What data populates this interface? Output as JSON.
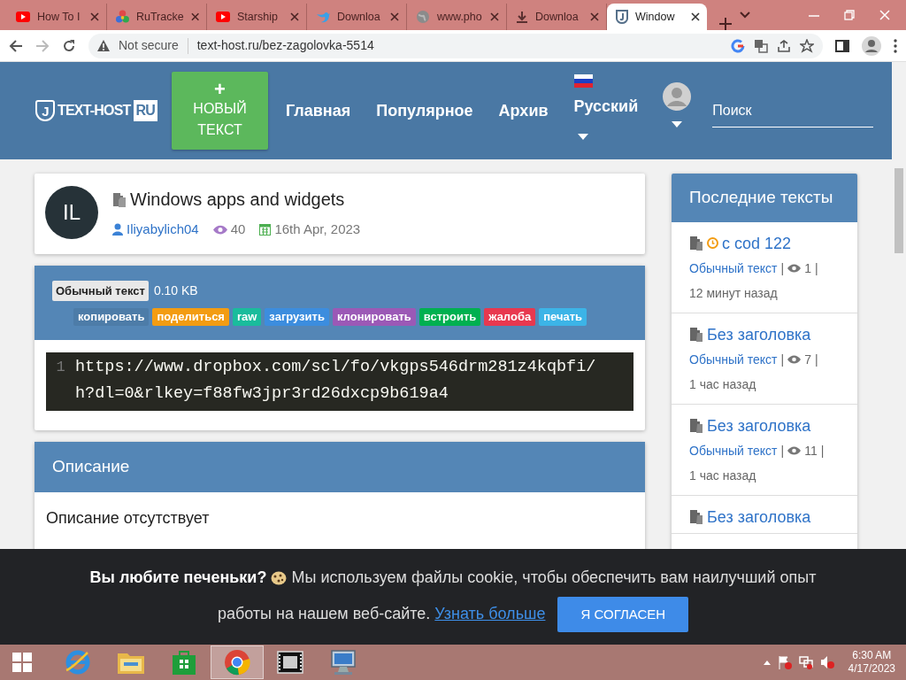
{
  "browser": {
    "tabs": [
      {
        "title": "How To I",
        "kind": "video",
        "selected": false
      },
      {
        "title": "RuTracke",
        "kind": "flower",
        "selected": false
      },
      {
        "title": "Starship",
        "kind": "video",
        "selected": false
      },
      {
        "title": "Downloa",
        "kind": "bird",
        "selected": false
      },
      {
        "title": "www.pho",
        "kind": "globe",
        "selected": false
      },
      {
        "title": "Downloa",
        "kind": "download",
        "selected": false
      },
      {
        "title": "Window",
        "kind": "shield",
        "selected": true
      }
    ],
    "nav_buttons": [
      {
        "kind": "back",
        "disabled": false
      },
      {
        "kind": "forward",
        "disabled": true
      },
      {
        "kind": "reload",
        "disabled": false
      }
    ],
    "security": "Not secure",
    "url": "text-host.ru/bez-zagolovka-5514"
  },
  "header": {
    "logo": {
      "mark": "J",
      "text": "TEXT-HOST",
      "suffix": "RU"
    },
    "new_button": {
      "icon": "+",
      "label": "НОВЫЙ ТЕКСТ"
    },
    "nav": [
      "Главная",
      "Популярное",
      "Архив"
    ],
    "language": "Русский",
    "search": {
      "placeholder": "Поиск"
    }
  },
  "paste": {
    "avatar": "IL",
    "title": "Windows apps and widgets",
    "author": "Iliyabylich04",
    "views": "40",
    "date": "16th Apr, 2023"
  },
  "toolbar": {
    "syntax": "Обычный текст",
    "size": "0.10 KB",
    "actions": [
      {
        "label": "копировать",
        "color": "#4d7ca8"
      },
      {
        "label": "поделиться",
        "color": "#f39c12"
      },
      {
        "label": "raw",
        "color": "#1abc9c"
      },
      {
        "label": "загрузить",
        "color": "#3c8dde"
      },
      {
        "label": "клонировать",
        "color": "#9b59b6"
      },
      {
        "label": "встроить",
        "color": "#00b050"
      },
      {
        "label": "жалоба",
        "color": "#e8384f"
      },
      {
        "label": "печать",
        "color": "#3cb4e7"
      }
    ]
  },
  "code": {
    "lines": [
      {
        "number": "1",
        "text": "https://www.dropbox.com/scl/fo/vkgps546drm281z4kqbfi/h?dl=0&rlkey=f88fw3jpr3rd26dxcp9b619a4"
      }
    ]
  },
  "description": {
    "title": "Описание",
    "text": "Описание отсутствует"
  },
  "sidebar": {
    "title": "Последние тексты",
    "items": [
      {
        "title": "c cod 122",
        "expiring": true,
        "syntax": "Обычный текст",
        "divider_1": "|",
        "views": "1",
        "divider_2": "|",
        "time": "12 минут назад"
      },
      {
        "title": "Без заголовка",
        "expiring": false,
        "syntax": "Обычный текст",
        "divider_1": "|",
        "views": "7",
        "divider_2": "|",
        "time": "1 час назад"
      },
      {
        "title": "Без заголовка",
        "expiring": false,
        "syntax": "Обычный текст",
        "divider_1": "|",
        "views": "11",
        "divider_2": "|",
        "time": "1 час назад"
      },
      {
        "title": "Без заголовка",
        "expiring": false
      }
    ]
  },
  "cookie": {
    "question": "Вы любите печеньки?",
    "text": [
      "Мы используем файлы cookie, чтобы обеспечить вам наилучший опыт",
      "работы на нашем веб-сайте."
    ],
    "link": "Узнать больше",
    "button": "Я СОГЛАСЕН"
  },
  "taskbar": {
    "apps": [
      {
        "kind": "browser-e",
        "selected": false
      },
      {
        "kind": "folder",
        "selected": false
      },
      {
        "kind": "store",
        "selected": false
      },
      {
        "kind": "chrome",
        "selected": true
      },
      {
        "kind": "film",
        "selected": false
      },
      {
        "kind": "remote",
        "selected": false
      }
    ],
    "time": "6:30 AM",
    "date": "4/17/2023"
  }
}
